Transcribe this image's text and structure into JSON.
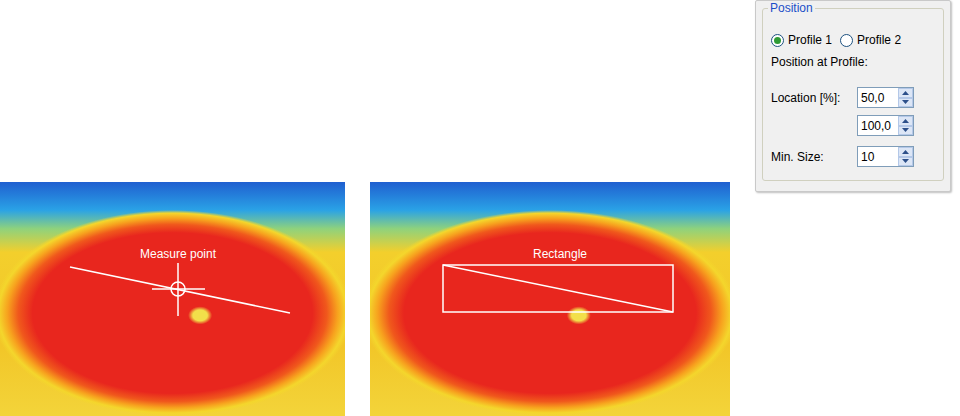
{
  "images": [
    {
      "label": "Measure point",
      "kind": "point"
    },
    {
      "label": "Rectangle",
      "kind": "rectangle"
    }
  ],
  "panel": {
    "title": "Position",
    "profiles": [
      {
        "label": "Profile 1",
        "selected": true
      },
      {
        "label": "Profile 2",
        "selected": false
      }
    ],
    "caption": "Position at Profile:",
    "fields": [
      {
        "label": "Location [%]:",
        "values": [
          "50,0",
          "100,0"
        ]
      },
      {
        "label": "Min. Size:",
        "values": [
          "10"
        ]
      }
    ]
  }
}
